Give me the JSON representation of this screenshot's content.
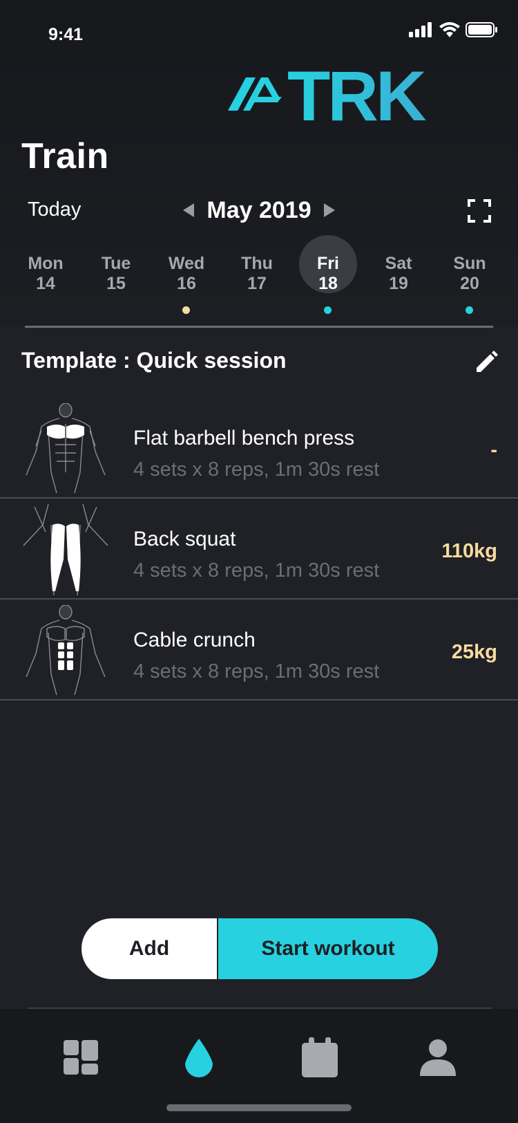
{
  "status_bar": {
    "time": "9:41"
  },
  "brand": {
    "logo_text": "TRK",
    "accent": "#27d1e0"
  },
  "page": {
    "title": "Train"
  },
  "calendar": {
    "today_label": "Today",
    "month_label": "May 2019",
    "days": [
      {
        "name": "Mon",
        "num": "14",
        "selected": false,
        "dot": null
      },
      {
        "name": "Tue",
        "num": "15",
        "selected": false,
        "dot": null
      },
      {
        "name": "Wed",
        "num": "16",
        "selected": false,
        "dot": "#f7dca0"
      },
      {
        "name": "Thu",
        "num": "17",
        "selected": false,
        "dot": null
      },
      {
        "name": "Fri",
        "num": "18",
        "selected": true,
        "dot": "#27d1e0"
      },
      {
        "name": "Sat",
        "num": "19",
        "selected": false,
        "dot": null
      },
      {
        "name": "Sun",
        "num": "20",
        "selected": false,
        "dot": "#27d1e0"
      }
    ]
  },
  "template": {
    "title": "Template : Quick session",
    "exercises": [
      {
        "name": "Flat barbell bench press",
        "detail": "4 sets x 8 reps, 1m 30s rest",
        "weight": "-",
        "muscle_icon": "chest-muscle-icon"
      },
      {
        "name": "Back squat",
        "detail": "4 sets x 8 reps, 1m 30s rest",
        "weight": "110kg",
        "muscle_icon": "legs-muscle-icon"
      },
      {
        "name": "Cable crunch",
        "detail": "4 sets x 8 reps, 1m 30s rest",
        "weight": "25kg",
        "muscle_icon": "abs-muscle-icon"
      }
    ]
  },
  "actions": {
    "add_label": "Add",
    "start_label": "Start workout"
  },
  "tabbar": {
    "items": [
      {
        "icon": "dashboard-icon",
        "active": false
      },
      {
        "icon": "drop-icon",
        "active": true
      },
      {
        "icon": "calendar-icon",
        "active": false
      },
      {
        "icon": "profile-icon",
        "active": false
      }
    ]
  }
}
